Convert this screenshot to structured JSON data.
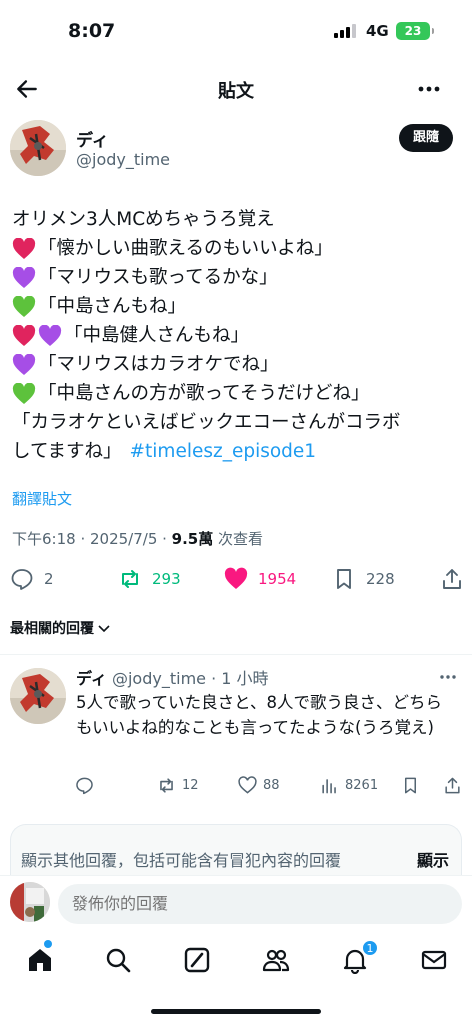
{
  "status_bar": {
    "time": "8:07",
    "network": "4G",
    "battery": "23"
  },
  "header": {
    "title": "貼文"
  },
  "post": {
    "author_name": "ディ",
    "author_handle": "@jody_time",
    "follow_label": "跟隨",
    "lines": [
      "オリメン3人MCめちゃうろ覚え",
      "「懐かしい曲歌えるのもいいよね」",
      "「マリウスも歌ってるかな」",
      "「中島さんもね」",
      "「中島健人さんもね」",
      "「マリウスはカラオケでね」",
      "「中島さんの方が歌ってそうだけどね」",
      "「カラオケといえばビックエコーさんがコラボ",
      "してますね」"
    ],
    "hashtag": "#timelesz_episode1",
    "translate_label": "翻譯貼文",
    "timestamp": "下午6:18 · 2025/7/5 · ",
    "views_count": "9.5萬",
    "views_label": " 次查看",
    "stats": {
      "replies": "2",
      "reposts": "293",
      "likes": "1954",
      "bookmarks": "228"
    }
  },
  "sort_label": "最相關的回覆",
  "reply": {
    "author_name": "ディ",
    "handle_time": "@jody_time · 1 小時",
    "text": "5人で歌っていた良さと、8人で歌う良さ、どちらもいいよね的なことも言ってたような(うろ覚え)",
    "stats": {
      "reposts": "12",
      "likes": "88",
      "views": "8261"
    }
  },
  "more_replies": {
    "text": "顯示其他回覆，包括可能含有冒犯內容的回覆",
    "action": "顯示"
  },
  "compose": {
    "placeholder": "發佈你的回覆"
  },
  "notifications_badge": "1",
  "colors": {
    "accent": "#1d9bf0",
    "repost": "#00ba7c",
    "like": "#f91880",
    "heart_red": "#e0245e",
    "heart_purple": "#a64ee6",
    "heart_green": "#5dc23c"
  }
}
